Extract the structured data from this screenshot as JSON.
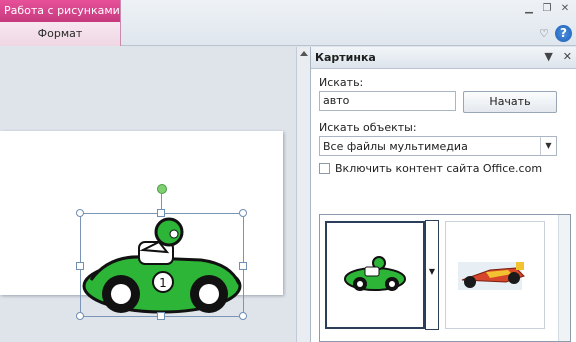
{
  "ribbon": {
    "context_tab_group": "Работа с рисунками",
    "context_tab": "Формат"
  },
  "task_pane": {
    "title": "Картинка",
    "search_label": "Искать:",
    "search_value": "авто",
    "start_button": "Начать",
    "search_objects_label": "Искать объекты:",
    "media_type_value": "Все файлы мультимедиа",
    "include_office_label": "Включить контент сайта Office.com",
    "include_office_checked": false,
    "results": [
      {
        "icon": "green-race-car-clipart-icon",
        "selected": true
      },
      {
        "icon": "formula-race-car-photo-icon",
        "selected": false
      }
    ]
  },
  "colors": {
    "context_tab": "#d0408a",
    "car_body": "#2db537",
    "help": "#1d5fb5"
  }
}
